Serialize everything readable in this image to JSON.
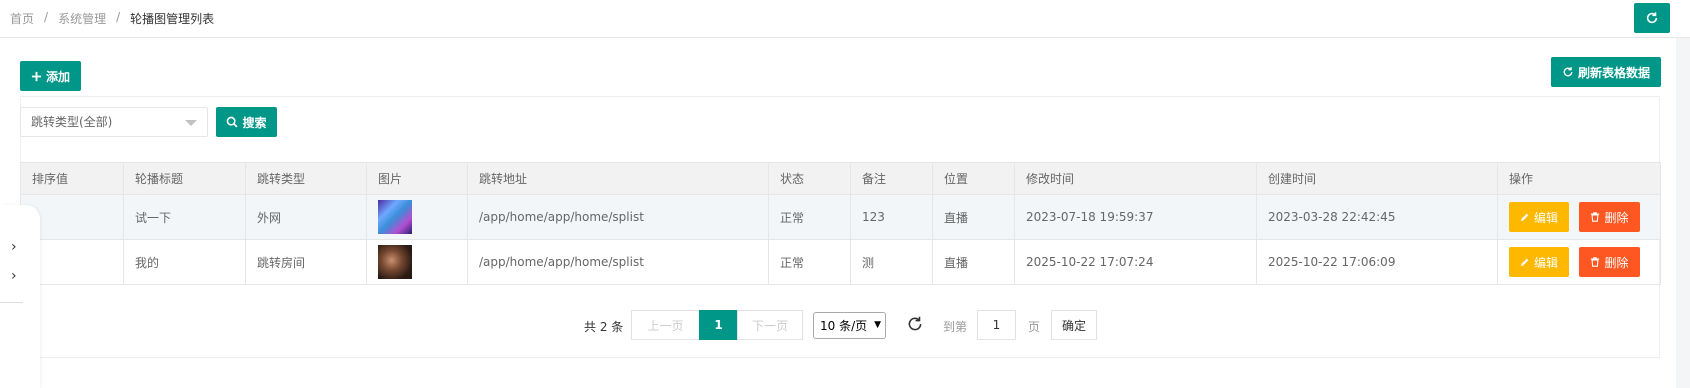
{
  "breadcrumb": {
    "home": "首页",
    "sep": "/",
    "section": "系统管理",
    "current": "轮播图管理列表"
  },
  "toolbar": {
    "add_label": "添加",
    "refresh_label": "刷新表格数据",
    "search_label": "搜索"
  },
  "filter": {
    "select_value": "跳转类型(全部)"
  },
  "table": {
    "headers": [
      "排序值",
      "轮播标题",
      "跳转类型",
      "图片",
      "跳转地址",
      "状态",
      "备注",
      "位置",
      "修改时间",
      "创建时间",
      "操作"
    ],
    "rows": [
      {
        "sort": "",
        "title": "试一下",
        "jump_type": "外网",
        "image": "thumbnail-1",
        "url": "/app/home/app/home/splist",
        "status": "正常",
        "remark": "123",
        "position": "直播",
        "modified": "2023-07-18 19:59:37",
        "created": "2023-03-28 22:42:45"
      },
      {
        "sort": "",
        "title": "我的",
        "jump_type": "跳转房间",
        "image": "thumbnail-2",
        "url": "/app/home/app/home/splist",
        "status": "正常",
        "remark": "测",
        "position": "直播",
        "modified": "2025-10-22 17:07:24",
        "created": "2025-10-22 17:06:09"
      }
    ],
    "edit_label": "编辑",
    "delete_label": "删除"
  },
  "pagination": {
    "total_text": "共 2 条",
    "prev_label": "上一页",
    "current_page": "1",
    "next_label": "下一页",
    "page_size": "10 条/页",
    "goto_label": "到第",
    "goto_value": "1",
    "page_unit": "页",
    "confirm_label": "确定"
  },
  "colors": {
    "primary": "#009688",
    "warning": "#ffb800",
    "danger": "#ff5722"
  },
  "icons": [
    "refresh-icon",
    "plus-icon",
    "search-icon",
    "edit-icon",
    "trash-icon",
    "chevron-right-icon",
    "reload-icon"
  ]
}
